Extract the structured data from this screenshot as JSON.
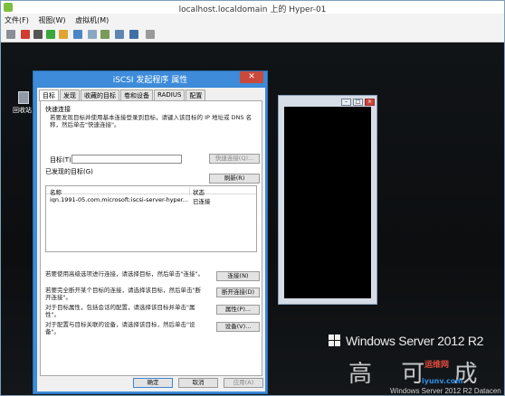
{
  "vm_window": {
    "title": "localhost.localdomain 上的 Hyper-01",
    "menu": [
      "文件(F)",
      "视图(W)",
      "虚拟机(M)"
    ],
    "toolbar_icons": [
      "ctrl-alt-del-icon",
      "stop-icon",
      "shutdown-icon",
      "start-icon",
      "pause-icon",
      "reset-icon",
      "checkpoint-icon",
      "revert-icon",
      "enhanced-session-icon",
      "share-icon",
      "type-clipboard-icon"
    ]
  },
  "desktop": {
    "recycle_bin_label": "回收站"
  },
  "branding": {
    "product": "Windows Server 2012 R2",
    "edition": "Windows Server 2012 R2 Datacen",
    "watermark": "高 可 成",
    "watermark_site": "运维网",
    "watermark_url": "iyunv.com"
  },
  "dialog": {
    "title": "iSCSI 发起程序 属性",
    "close": "✕",
    "tabs": [
      "目标",
      "发现",
      "收藏的目标",
      "卷和设备",
      "RADIUS",
      "配置"
    ],
    "quick_connect": {
      "title": "快速连接",
      "note": "若要发现目标并使用基本连接登录到目标，请键入该目标的 IP 地址或 DNS 名称，然后单击\"快速连接\"。",
      "target_label": "目标(T):",
      "target_value": "",
      "quick_connect_button": "快速连接(Q)..."
    },
    "discovered": {
      "title": "已发现的目标(G)",
      "refresh_button": "刷新(R)",
      "columns": [
        "名称",
        "状态"
      ],
      "rows": [
        {
          "name": "iqn.1991-05.com.microsoft:iscsi-server-hyper...",
          "status": "已连接"
        }
      ]
    },
    "actions": [
      {
        "note": "若要使用高级选项进行连接，请选择目标，然后单击\"连接\"。",
        "button": "连接(N)"
      },
      {
        "note": "若要完全断开某个目标的连接，请选择该目标，然后单击\"断开连接\"。",
        "button": "断开连接(D)"
      },
      {
        "note": "对于目标属性，包括会话的配置，请选择该目标并单击\"属性\"。",
        "button": "属性(P)..."
      },
      {
        "note": "对于配置与目标关联的设备，请选择该目标，然后单击\"设备\"。",
        "button": "设备(V)..."
      }
    ],
    "footer": {
      "ok": "确定",
      "cancel": "取消",
      "apply": "应用(A)"
    }
  },
  "colors": {
    "dialog_title_bar": "#3d8bd9",
    "close_button": "#c94a3c",
    "desktop_bg": "#0d1012"
  }
}
